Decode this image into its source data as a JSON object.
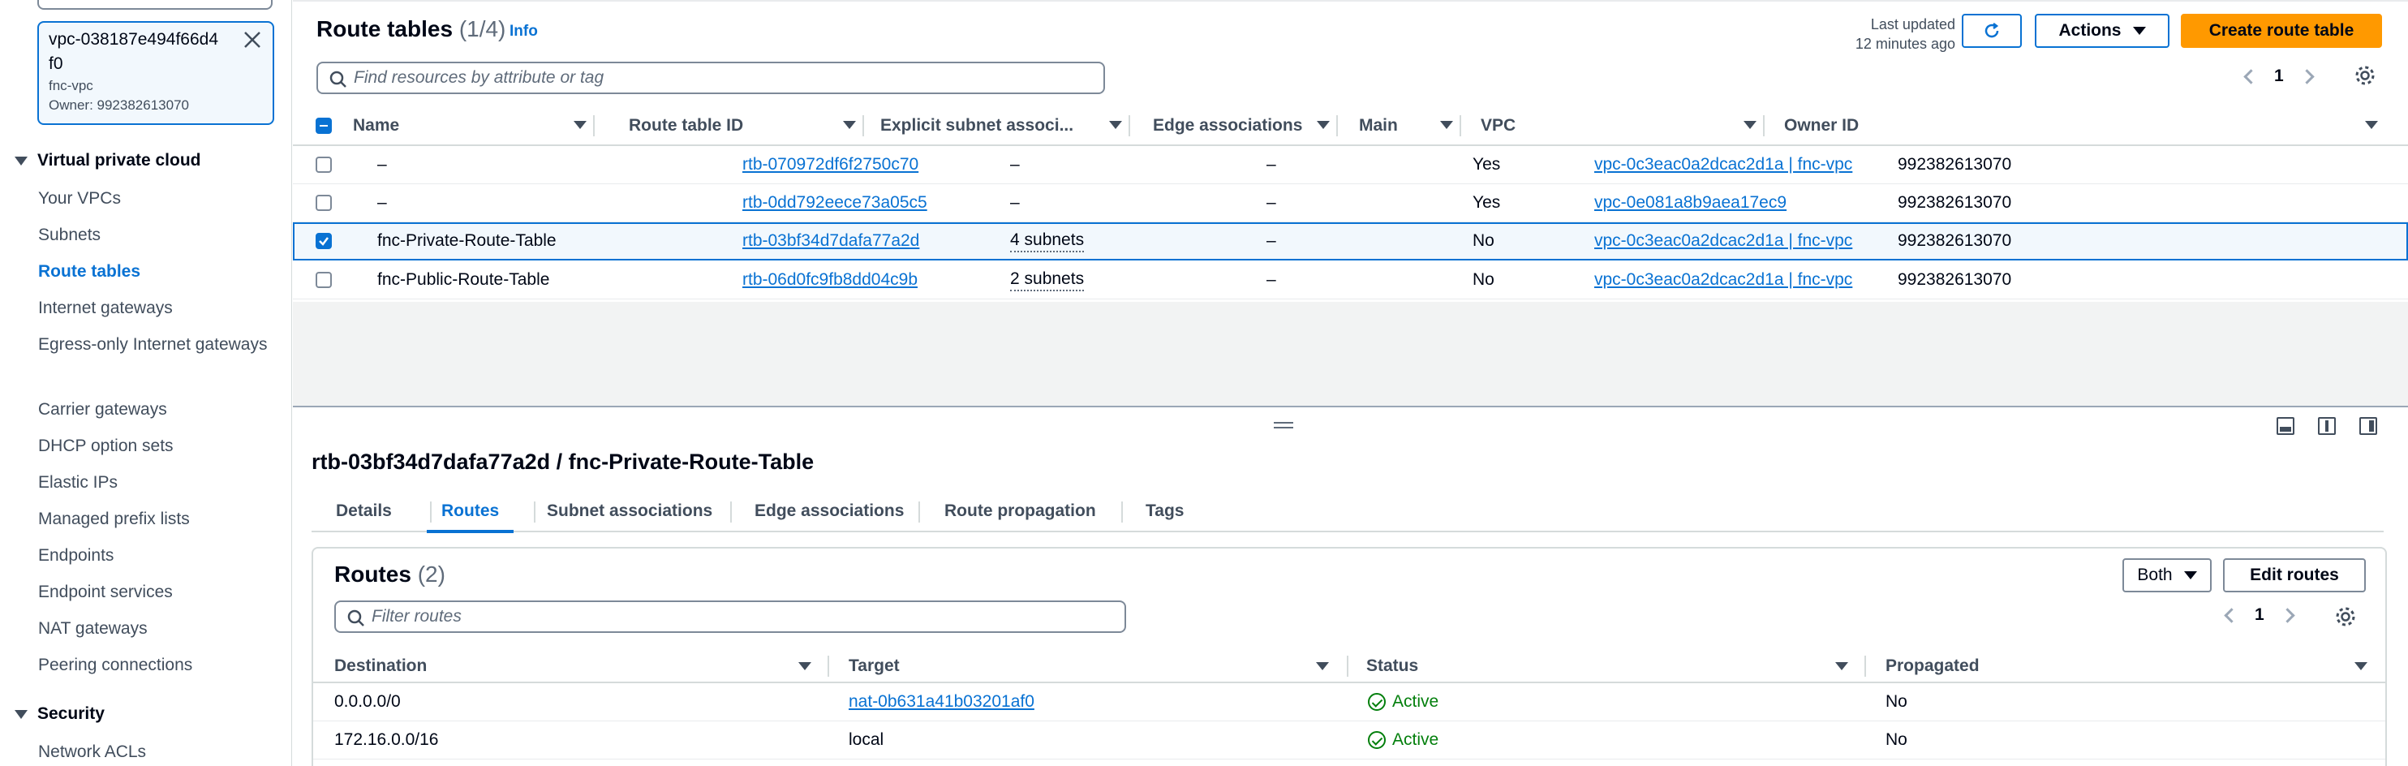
{
  "sidebar": {
    "vpc_filter": {
      "id": "vpc-038187e494f66d4f0",
      "name": "fnc-vpc",
      "owner": "Owner: 992382613070"
    },
    "section_vpc": "Virtual private cloud",
    "items": [
      "Your VPCs",
      "Subnets",
      "Route tables",
      "Internet gateways",
      "Egress-only Internet gateways",
      "Carrier gateways",
      "DHCP option sets",
      "Elastic IPs",
      "Managed prefix lists",
      "Endpoints",
      "Endpoint services",
      "NAT gateways",
      "Peering connections"
    ],
    "active_item": "Route tables",
    "section_security": "Security",
    "security_items": [
      "Network ACLs"
    ]
  },
  "header": {
    "title": "Route tables",
    "count": "(1/4)",
    "info": "Info",
    "last_updated_line1": "Last updated",
    "last_updated_line2": "12 minutes ago",
    "actions_label": "Actions",
    "create_label": "Create route table",
    "search_placeholder": "Find resources by attribute or tag",
    "page": "1"
  },
  "table": {
    "columns": [
      "Name",
      "Route table ID",
      "Explicit subnet associ...",
      "Edge associations",
      "Main",
      "VPC",
      "Owner ID"
    ],
    "rows": [
      {
        "name": "–",
        "id": "rtb-070972df6f2750c70",
        "subnets": "–",
        "edge": "–",
        "main": "Yes",
        "vpc": "vpc-0c3eac0a2dcac2d1a | fnc-vpc",
        "owner": "992382613070",
        "selected": false
      },
      {
        "name": "–",
        "id": "rtb-0dd792eece73a05c5",
        "subnets": "–",
        "edge": "–",
        "main": "Yes",
        "vpc": "vpc-0e081a8b9aea17ec9",
        "owner": "992382613070",
        "selected": false
      },
      {
        "name": "fnc-Private-Route-Table",
        "id": "rtb-03bf34d7dafa77a2d",
        "subnets": "4 subnets",
        "edge": "–",
        "main": "No",
        "vpc": "vpc-0c3eac0a2dcac2d1a | fnc-vpc",
        "owner": "992382613070",
        "selected": true
      },
      {
        "name": "fnc-Public-Route-Table",
        "id": "rtb-06d0fc9fb8dd04c9b",
        "subnets": "2 subnets",
        "edge": "–",
        "main": "No",
        "vpc": "vpc-0c3eac0a2dcac2d1a | fnc-vpc",
        "owner": "992382613070",
        "selected": false
      }
    ]
  },
  "details": {
    "title": "rtb-03bf34d7dafa77a2d / fnc-Private-Route-Table",
    "tabs": [
      "Details",
      "Routes",
      "Subnet associations",
      "Edge associations",
      "Route propagation",
      "Tags"
    ],
    "active_tab": "Routes",
    "routes": {
      "title": "Routes",
      "count": "(2)",
      "both_label": "Both",
      "edit_label": "Edit routes",
      "filter_placeholder": "Filter routes",
      "page": "1",
      "columns": [
        "Destination",
        "Target",
        "Status",
        "Propagated"
      ],
      "rows": [
        {
          "destination": "0.0.0.0/0",
          "target": "nat-0b631a41b03201af0",
          "target_link": true,
          "status": "Active",
          "propagated": "No"
        },
        {
          "destination": "172.16.0.0/16",
          "target": "local",
          "target_link": false,
          "status": "Active",
          "propagated": "No"
        }
      ]
    }
  },
  "colors": {
    "accent": "#0972d3",
    "primary_button": "#ff9900",
    "success": "#037f0c"
  }
}
